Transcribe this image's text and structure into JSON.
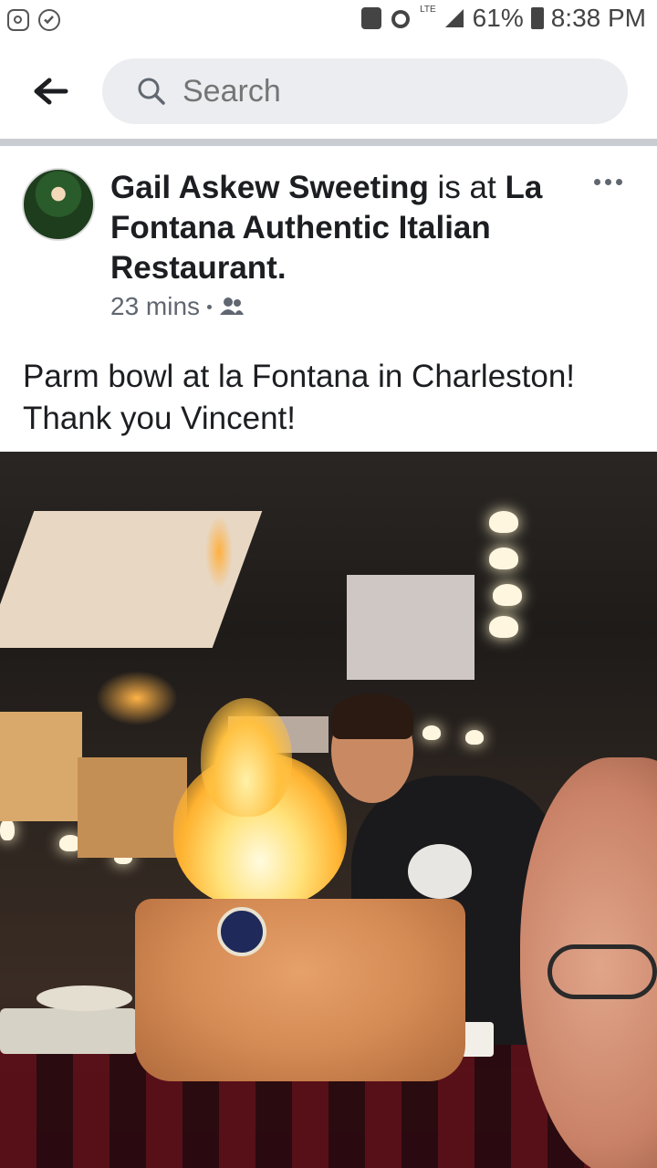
{
  "status_bar": {
    "battery": "61%",
    "network": "LTE",
    "time": "8:38 PM"
  },
  "header": {
    "search_placeholder": "Search"
  },
  "post": {
    "author": "Gail Askew Sweeting",
    "connector": " is at ",
    "place": "La Fontana Authentic Italian Restaurant.",
    "time": "23 mins",
    "audience_icon": "friends-icon",
    "text_line1": "Parm bowl at la Fontana in Charleston!",
    "text_line2": "Thank you Vincent!"
  },
  "colors": {
    "accent_text": "#1c1e21",
    "muted_text": "#606770",
    "search_bg": "#ebedf0"
  }
}
